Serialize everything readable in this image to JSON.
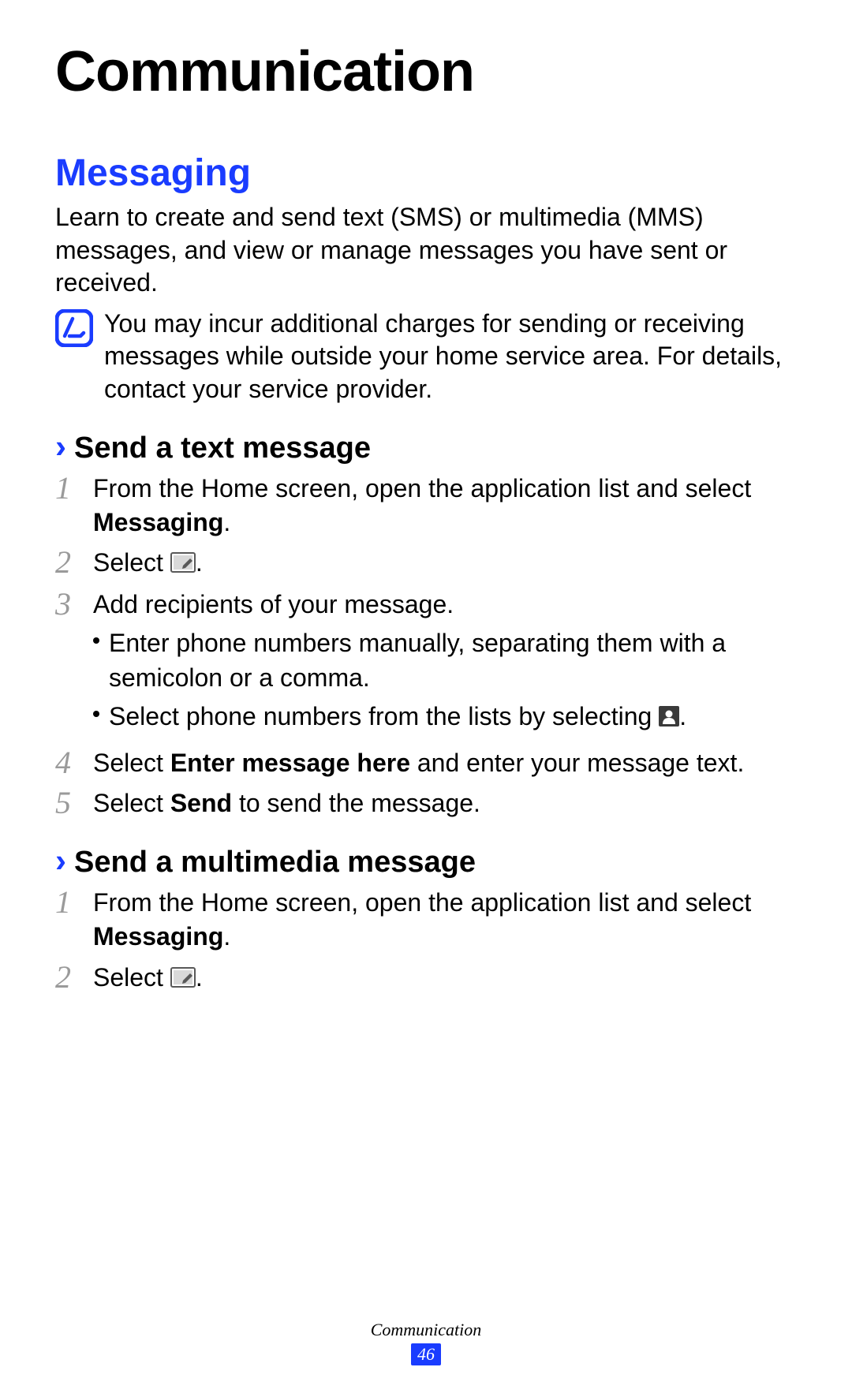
{
  "chapter_title": "Communication",
  "section_title": "Messaging",
  "intro": "Learn to create and send text (SMS) or multimedia (MMS) messages, and view or manage messages you have sent or received.",
  "note": "You may incur additional charges for sending or receiving messages while outside your home service area. For details, contact your service provider.",
  "sub1": {
    "title": "Send a text message",
    "step1_a": "From the Home screen, open the application list and select ",
    "step1_bold": "Messaging",
    "step1_b": ".",
    "step2_a": "Select ",
    "step2_b": ".",
    "step3": "Add recipients of your message.",
    "bullet1": "Enter phone numbers manually, separating them with a semicolon or a comma.",
    "bullet2_a": "Select phone numbers from the lists by selecting ",
    "bullet2_b": ".",
    "step4_a": "Select ",
    "step4_bold": "Enter message here",
    "step4_b": " and enter your message text.",
    "step5_a": "Select ",
    "step5_bold": "Send",
    "step5_b": " to send the message."
  },
  "sub2": {
    "title": "Send a multimedia message",
    "step1_a": "From the Home screen, open the application list and select ",
    "step1_bold": "Messaging",
    "step1_b": ".",
    "step2_a": "Select ",
    "step2_b": "."
  },
  "nums": {
    "n1": "1",
    "n2": "2",
    "n3": "3",
    "n4": "4",
    "n5": "5"
  },
  "chevron": "›",
  "footer": {
    "label": "Communication",
    "page": "46"
  }
}
